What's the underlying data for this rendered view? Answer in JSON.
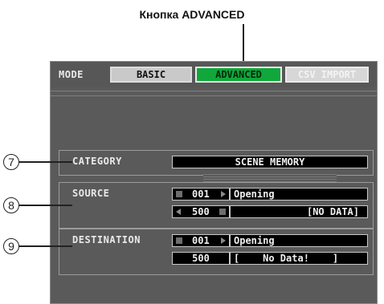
{
  "caption": "Кнопка ADVANCED",
  "mode": {
    "label": "MODE",
    "buttons": [
      {
        "label": "BASIC",
        "state": "normal"
      },
      {
        "label": "ADVANCED",
        "state": "active"
      },
      {
        "label": "CSV IMPORT",
        "state": "disabled"
      }
    ]
  },
  "category": {
    "callout": "7",
    "label": "CATEGORY",
    "value": "SCENE MEMORY"
  },
  "source": {
    "callout": "8",
    "label": "SOURCE",
    "rows": [
      {
        "number": "001",
        "name": "Opening"
      },
      {
        "number": "500",
        "name": "[NO DATA]"
      }
    ]
  },
  "destination": {
    "callout": "9",
    "label": "DESTINATION",
    "rows": [
      {
        "number": "001",
        "name": "Opening"
      },
      {
        "number": "500",
        "name": "[    No Data!    ]"
      }
    ]
  },
  "colors": {
    "active_green": "#10a83a",
    "panel_gray": "#5a5a5a",
    "field_black": "#000000"
  },
  "icons": [
    "circle-number-icon",
    "left-arrow-icon",
    "right-arrow-icon"
  ]
}
